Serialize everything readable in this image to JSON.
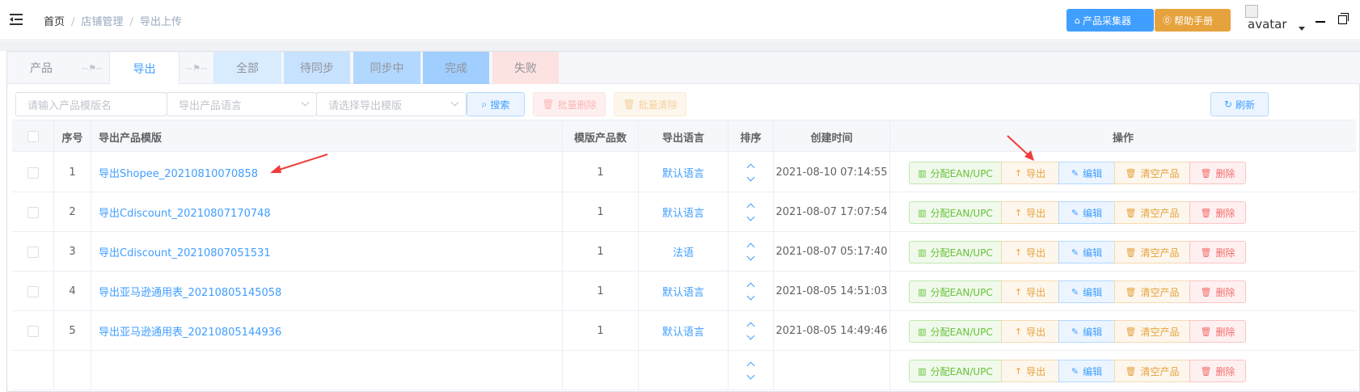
{
  "header": {
    "breadcrumb": [
      "首页",
      "店铺管理",
      "导出上传"
    ],
    "collector_button": "产品采集器",
    "help_button": "帮助手册",
    "avatar_alt": "avatar"
  },
  "tabs": {
    "product": "产品",
    "export": "导出",
    "all": "全部",
    "pending": "待同步",
    "syncing": "同步中",
    "done": "完成",
    "fail": "失败"
  },
  "filters": {
    "template_name_placeholder": "请输入产品模版名",
    "language_placeholder": "导出产品语言",
    "template_select_placeholder": "请选择导出模版",
    "search_label": "搜索",
    "batch_delete_label": "批量删除",
    "batch_clear_label": "批量清除",
    "refresh_label": "刷新"
  },
  "table": {
    "columns": {
      "index": "序号",
      "template": "导出产品模版",
      "count": "模版产品数",
      "language": "导出语言",
      "sort": "排序",
      "created": "创建时间",
      "actions": "操作"
    },
    "actions": {
      "assign": "分配EAN/UPC",
      "export": "导出",
      "edit": "编辑",
      "clear": "清空产品",
      "delete": "删除"
    },
    "rows": [
      {
        "index": "1",
        "template": "导出Shopee_20210810070858",
        "count": "1",
        "language": "默认语言",
        "created": "2021-08-10 07:14:55"
      },
      {
        "index": "2",
        "template": "导出Cdiscount_20210807170748",
        "count": "1",
        "language": "默认语言",
        "created": "2021-08-07 17:07:54"
      },
      {
        "index": "3",
        "template": "导出Cdiscount_20210807051531",
        "count": "1",
        "language": "法语",
        "created": "2021-08-07 05:17:40"
      },
      {
        "index": "4",
        "template": "导出亚马逊通用表_20210805145058",
        "count": "1",
        "language": "默认语言",
        "created": "2021-08-05 14:51:03"
      },
      {
        "index": "5",
        "template": "导出亚马逊通用表_20210805144936",
        "count": "1",
        "language": "默认语言",
        "created": "2021-08-05 14:49:46"
      }
    ]
  },
  "colors": {
    "primary": "#409eff",
    "warning": "#e6a23c",
    "success": "#67c23a",
    "danger": "#f56c6c",
    "annotation_arrow": "#f03c3c"
  }
}
